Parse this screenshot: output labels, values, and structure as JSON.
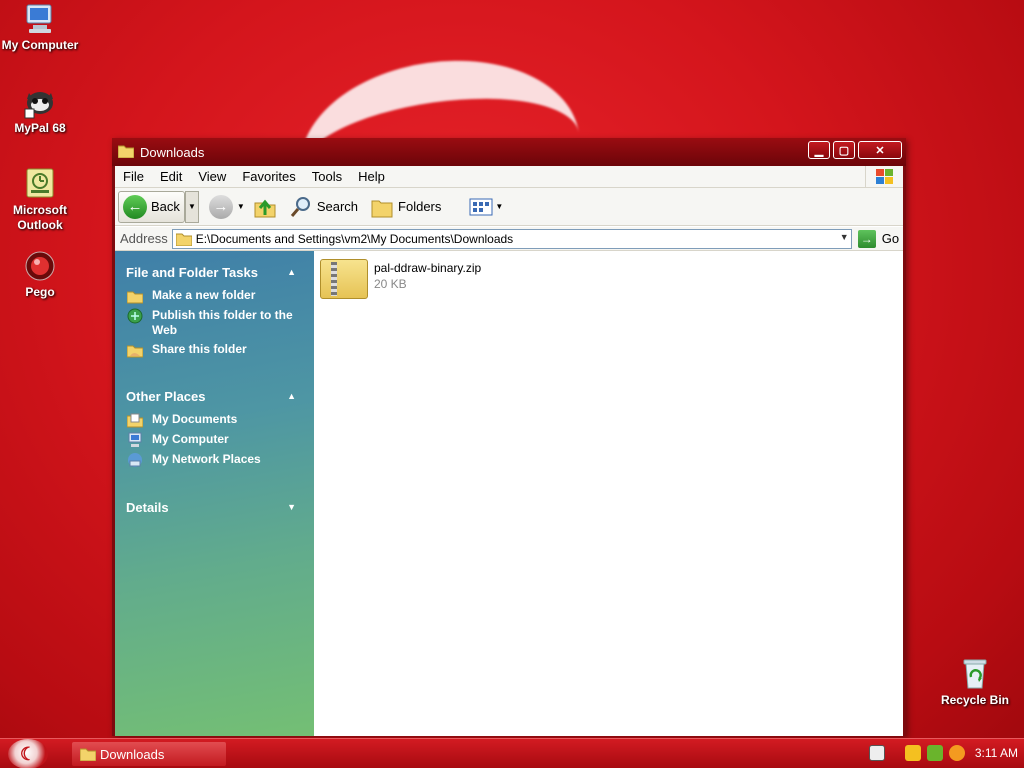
{
  "desktop": {
    "icons": [
      {
        "label": "My Computer"
      },
      {
        "label": "MyPal 68"
      },
      {
        "label": "Microsoft Outlook"
      },
      {
        "label": "Pego"
      },
      {
        "label": "Recycle Bin"
      }
    ]
  },
  "window": {
    "title": "Downloads",
    "menu": [
      "File",
      "Edit",
      "View",
      "Favorites",
      "Tools",
      "Help"
    ],
    "toolbar": {
      "back": "Back",
      "search": "Search",
      "folders": "Folders"
    },
    "address": {
      "label": "Address",
      "value": "E:\\Documents and Settings\\vm2\\My Documents\\Downloads",
      "go": "Go"
    },
    "taskpane": {
      "file_tasks": {
        "title": "File and Folder Tasks",
        "items": [
          "Make a new folder",
          "Publish this folder to the Web",
          "Share this folder"
        ]
      },
      "other_places": {
        "title": "Other Places",
        "items": [
          "My Documents",
          "My Computer",
          "My Network Places"
        ]
      },
      "details": {
        "title": "Details"
      }
    },
    "files": [
      {
        "name": "pal-ddraw-binary.zip",
        "size": "20 KB"
      }
    ]
  },
  "taskbar": {
    "task": "Downloads",
    "clock": "3:11 AM"
  },
  "colors": {
    "desktop": "#d4151c",
    "taskpane_top": "#3f7fa8",
    "taskpane_bottom": "#74bf74"
  }
}
